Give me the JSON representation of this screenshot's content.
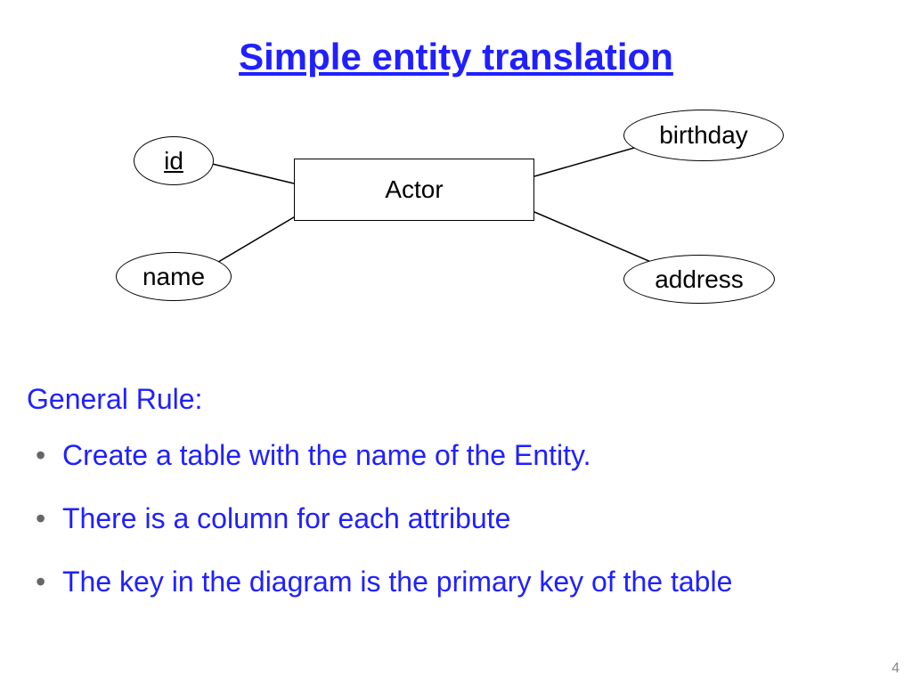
{
  "slide": {
    "title": "Simple entity translation",
    "page_number": "4"
  },
  "er_diagram": {
    "entity": "Actor",
    "attributes": {
      "id": {
        "label": "id",
        "is_key": true
      },
      "name": {
        "label": "name",
        "is_key": false
      },
      "birthday": {
        "label": "birthday",
        "is_key": false
      },
      "address": {
        "label": "address",
        "is_key": false
      }
    }
  },
  "rule": {
    "heading": "General Rule:",
    "bullets": [
      "Create a table with the name of the Entity.",
      "There is a column for each attribute",
      "The key in the diagram is the primary key of the table"
    ]
  }
}
